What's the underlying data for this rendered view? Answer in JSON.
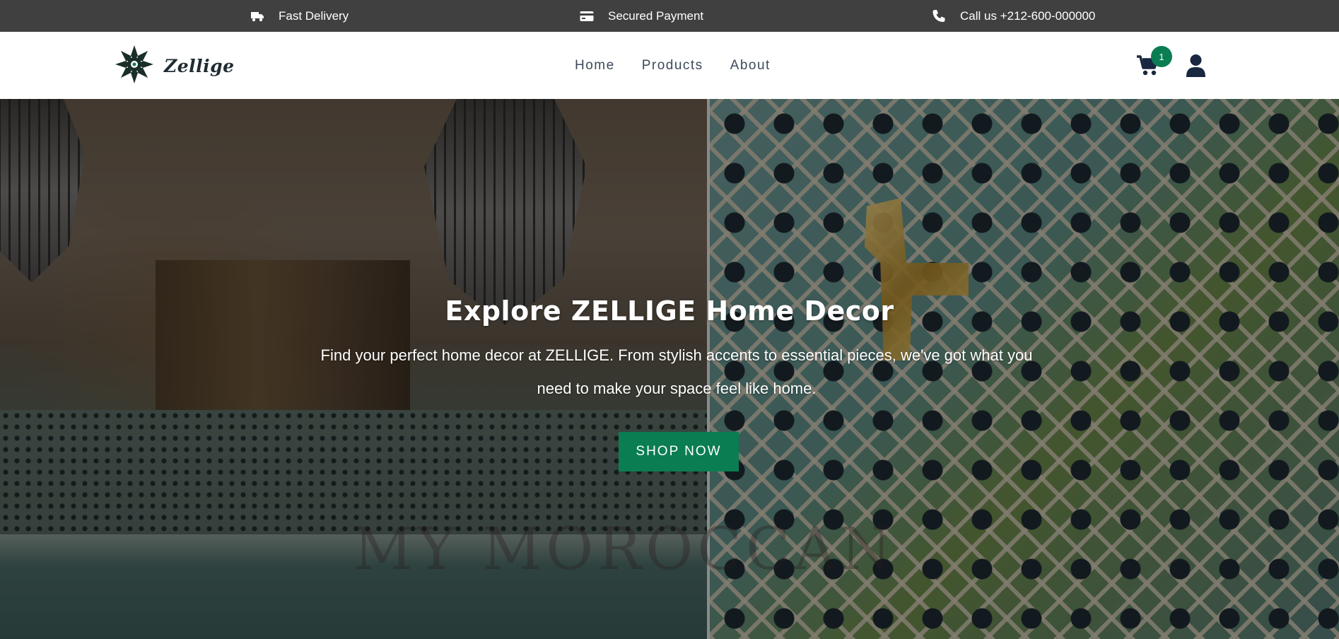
{
  "topbar": {
    "delivery": {
      "icon": "truck-icon",
      "text": "Fast Delivery"
    },
    "payment": {
      "icon": "credit-card-icon",
      "text": "Secured Payment"
    },
    "phone": {
      "icon": "phone-icon",
      "text": "Call us +212-600-000000"
    }
  },
  "header": {
    "logo_icon": "zellige-star-logo-icon",
    "brand": "Zellige",
    "nav": [
      "Home",
      "Products",
      "About"
    ],
    "cart_count": "1",
    "cart_icon": "shopping-cart-icon",
    "account_icon": "user-icon"
  },
  "hero": {
    "title": "Explore ZELLIGE Home Decor",
    "subtitle": "Find your perfect home decor at ZELLIGE. From stylish accents to essential pieces, we've got what you need to make your space feel like home.",
    "button": "SHOP NOW",
    "watermark": "MY MOROCCAN"
  },
  "colors": {
    "topbar_bg": "#404040",
    "accent_green": "#0a7d52",
    "nav_text": "#3d4a5a",
    "dark_navy": "#1a2740"
  }
}
